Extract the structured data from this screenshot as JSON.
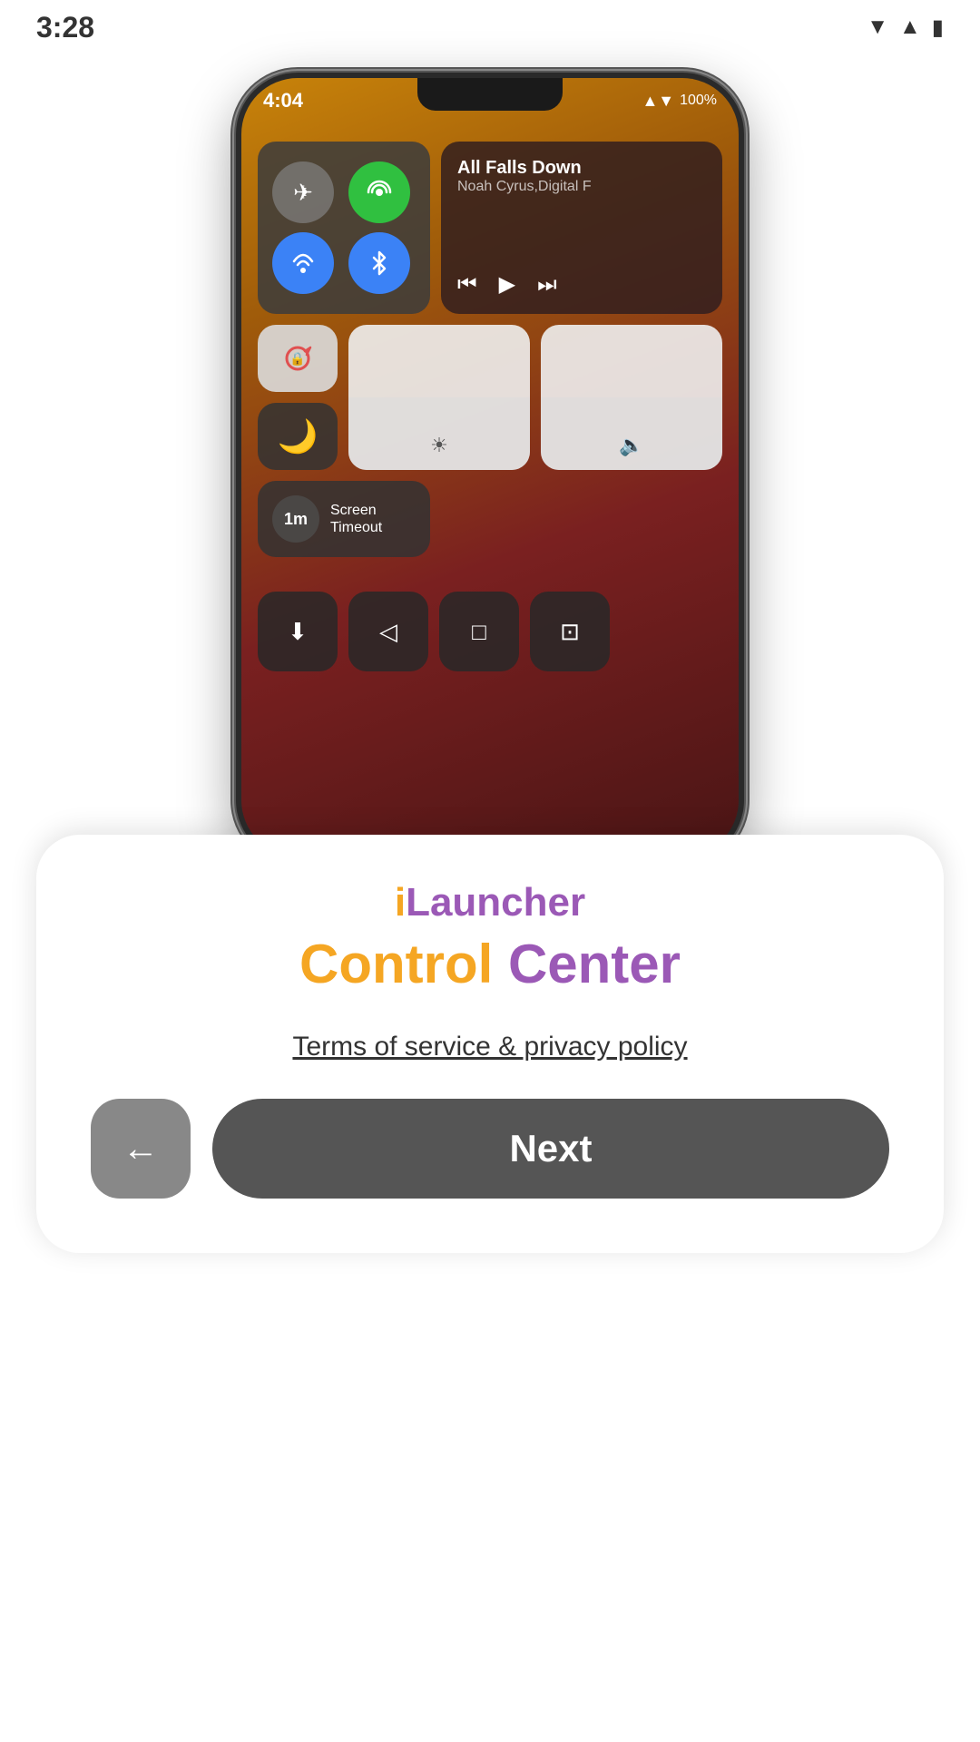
{
  "statusBar": {
    "time": "3:28",
    "wifiIcon": "▼",
    "signalIcon": "▲",
    "batteryIcon": "⚡"
  },
  "phoneScreen": {
    "statusBar": {
      "time": "4:04",
      "signalIcon": "▲",
      "batteryLevel": "100%"
    },
    "controlCenter": {
      "connectivity": {
        "airplaneMode": "✈",
        "hotspot": "((·))",
        "wifi": "WiFi",
        "bluetooth": "BT"
      },
      "music": {
        "title": "All Falls Down",
        "artist": "Noah Cyrus,Digital F",
        "prevIcon": "⏮",
        "playIcon": "▶",
        "nextIcon": "⏭"
      },
      "rotation": {
        "icon": "🔄"
      },
      "moon": {
        "icon": "🌙"
      },
      "screenTimeout": {
        "value": "1m",
        "label": "Screen\nTimeout"
      }
    }
  },
  "bottomCard": {
    "appNamePrefix": "i",
    "appNameSuffix": "Launcher",
    "subtitlePart1": "Control",
    "subtitlePart2": "Center",
    "termsLabel": "Terms of service & privacy policy",
    "backArrow": "←",
    "nextLabel": "Next"
  }
}
